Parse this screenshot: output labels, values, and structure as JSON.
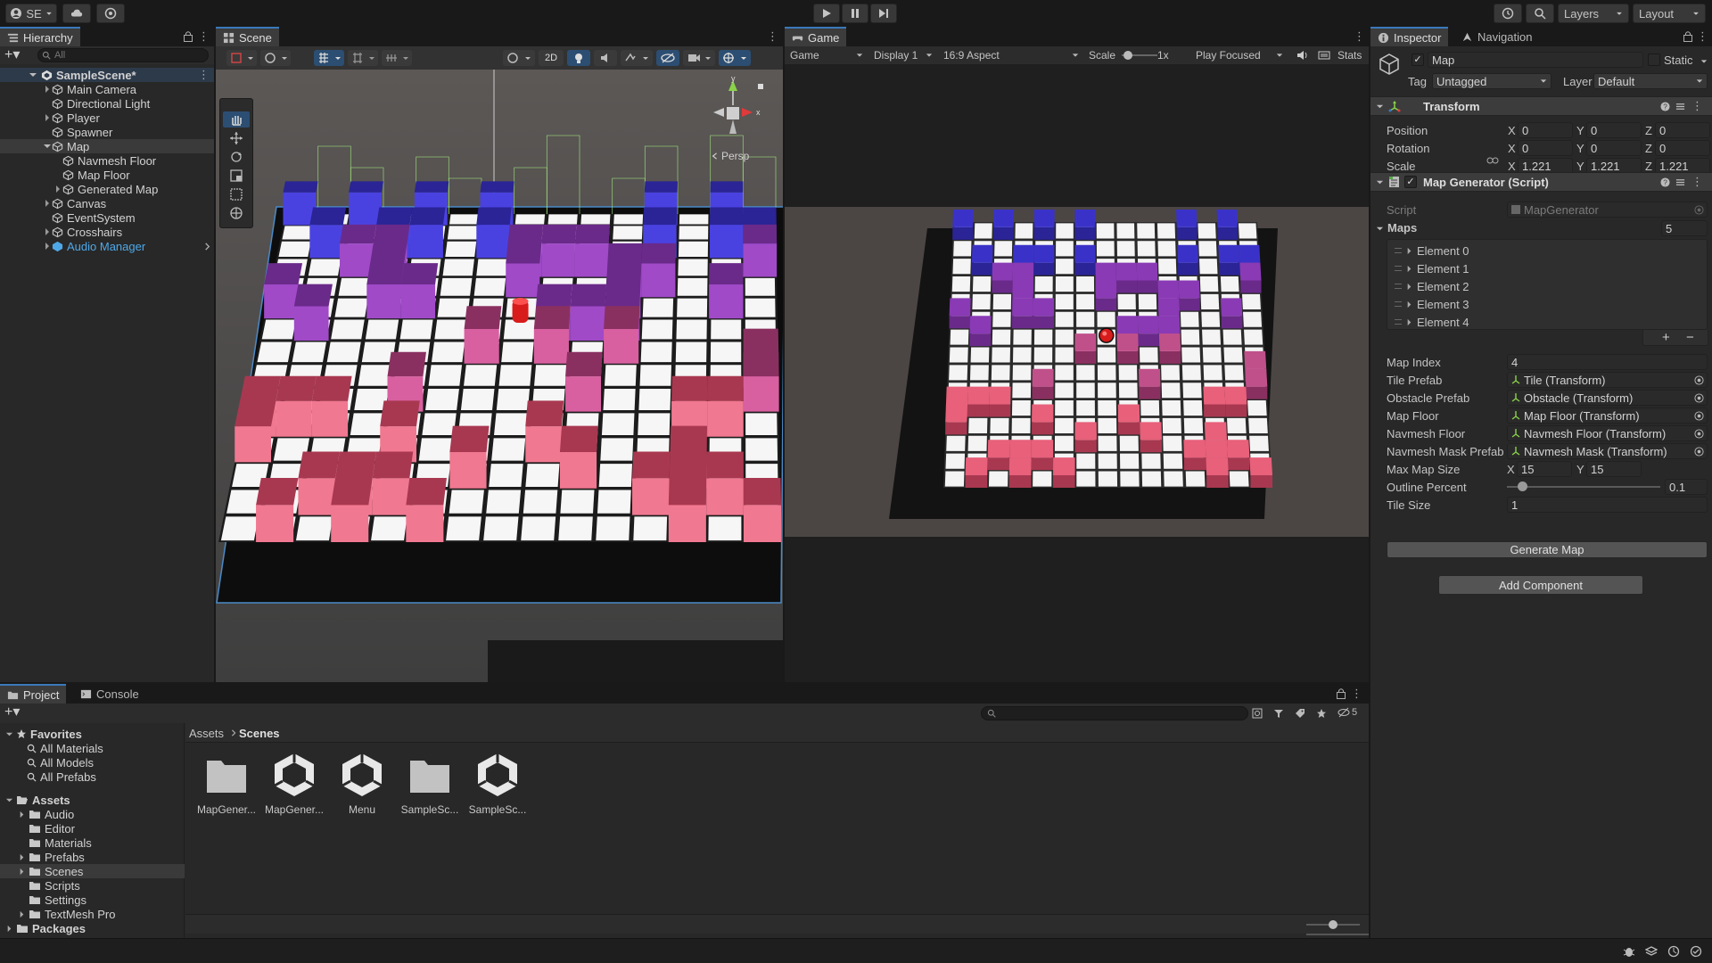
{
  "topbar": {
    "account_label": "SE",
    "layers_label": "Layers",
    "layout_label": "Layout"
  },
  "hierarchy": {
    "tab_label": "Hierarchy",
    "search_placeholder": "All",
    "scene_name": "SampleScene*",
    "items": [
      {
        "label": "Main Camera"
      },
      {
        "label": "Directional Light"
      },
      {
        "label": "Player"
      },
      {
        "label": "Spawner"
      },
      {
        "label": "Map"
      },
      {
        "label": "Navmesh Floor"
      },
      {
        "label": "Map Floor"
      },
      {
        "label": "Generated Map"
      },
      {
        "label": "Canvas"
      },
      {
        "label": "EventSystem"
      },
      {
        "label": "Crosshairs"
      },
      {
        "label": "Audio Manager"
      }
    ]
  },
  "scene": {
    "tab_label": "Scene",
    "mode_2d": "2D",
    "persp_label": "Persp",
    "gizmo_y": "y",
    "gizmo_x": "x"
  },
  "game": {
    "tab_label": "Game",
    "game_dropdown": "Game",
    "display_dropdown": "Display 1",
    "aspect_dropdown": "16:9 Aspect",
    "scale_label": "Scale",
    "scale_value": "1x",
    "play_focused": "Play Focused",
    "stats_label": "Stats"
  },
  "inspector": {
    "tab_label": "Inspector",
    "nav_tab_label": "Navigation",
    "object_name": "Map",
    "static_label": "Static",
    "tag_label": "Tag",
    "tag_value": "Untagged",
    "layer_label": "Layer",
    "layer_value": "Default",
    "transform": {
      "title": "Transform",
      "position_label": "Position",
      "rotation_label": "Rotation",
      "scale_label": "Scale",
      "axis_x": "X",
      "axis_y": "Y",
      "axis_z": "Z",
      "position": [
        "0",
        "0",
        "0"
      ],
      "rotation": [
        "0",
        "0",
        "0"
      ],
      "scale": [
        "1.221",
        "1.221",
        "1.221"
      ]
    },
    "map_generator": {
      "title": "Map Generator (Script)",
      "script_label": "Script",
      "script_value": "MapGenerator",
      "maps_label": "Maps",
      "maps_count": "5",
      "elements": [
        "Element 0",
        "Element 1",
        "Element 2",
        "Element 3",
        "Element 4"
      ],
      "plus": "+",
      "minus": "−",
      "map_index_label": "Map Index",
      "map_index_value": "4",
      "tile_prefab_label": "Tile Prefab",
      "tile_prefab_value": "Tile (Transform)",
      "obstacle_prefab_label": "Obstacle Prefab",
      "obstacle_prefab_value": "Obstacle (Transform)",
      "map_floor_label": "Map Floor",
      "map_floor_value": "Map Floor (Transform)",
      "navmesh_floor_label": "Navmesh Floor",
      "navmesh_floor_value": "Navmesh Floor (Transform)",
      "navmesh_mask_label": "Navmesh Mask Prefab",
      "navmesh_mask_value": "Navmesh Mask (Transform)",
      "max_map_size_label": "Max Map Size",
      "max_x_label": "X",
      "max_x": "15",
      "max_y_label": "Y",
      "max_y": "15",
      "outline_label": "Outline Percent",
      "outline_value": "0.1",
      "tile_size_label": "Tile Size",
      "tile_size_value": "1",
      "generate_button": "Generate Map"
    },
    "add_component": "Add Component"
  },
  "project": {
    "tab_label": "Project",
    "console_tab_label": "Console",
    "hidden_count": "5",
    "favorites_label": "Favorites",
    "favorites": [
      "All Materials",
      "All Models",
      "All Prefabs"
    ],
    "assets_label": "Assets",
    "folders": [
      "Audio",
      "Editor",
      "Materials",
      "Prefabs",
      "Scenes",
      "Scripts",
      "Settings",
      "TextMesh Pro"
    ],
    "packages_label": "Packages",
    "breadcrumb": [
      "Assets",
      "Scenes"
    ],
    "assets": [
      {
        "label": "MapGener...",
        "kind": "folder-icon"
      },
      {
        "label": "MapGener...",
        "kind": "unity-scene-icon"
      },
      {
        "label": "Menu",
        "kind": "unity-scene-icon"
      },
      {
        "label": "SampleSc...",
        "kind": "folder-icon"
      },
      {
        "label": "SampleSc...",
        "kind": "unity-scene-icon"
      }
    ]
  },
  "colors": {
    "accent": "#3a79bb",
    "obstacle_blue": "#3a32c8",
    "obstacle_purple": "#8a3ab5",
    "obstacle_pink": "#e8607a",
    "player_red": "#d81b1b"
  }
}
